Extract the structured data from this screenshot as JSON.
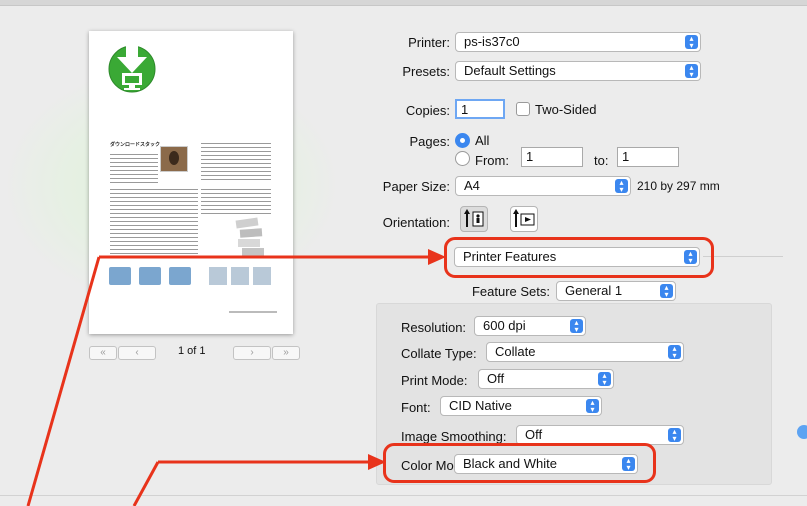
{
  "printer": {
    "label": "Printer:",
    "value": "ps-is37c0"
  },
  "presets": {
    "label": "Presets:",
    "value": "Default Settings"
  },
  "copies": {
    "label": "Copies:",
    "value": "1",
    "two_sided_label": "Two-Sided"
  },
  "pages": {
    "label": "Pages:",
    "all_label": "All",
    "from_label": "From:",
    "from_value": "1",
    "to_label": "to:",
    "to_value": "1"
  },
  "paper_size": {
    "label": "Paper Size:",
    "value": "A4",
    "dimensions": "210 by 297 mm"
  },
  "orientation": {
    "label": "Orientation:"
  },
  "section_menu": {
    "value": "Printer Features"
  },
  "feature_sets": {
    "label": "Feature Sets:",
    "value": "General 1"
  },
  "features": [
    {
      "label": "Resolution:",
      "value": "600 dpi"
    },
    {
      "label": "Collate Type:",
      "value": "Collate"
    },
    {
      "label": "Print Mode:",
      "value": "Off"
    },
    {
      "label": "Font:",
      "value": "CID Native"
    },
    {
      "label": "Image Smoothing:",
      "value": "Off"
    },
    {
      "label": "Color Mode:",
      "value": "Black and White"
    }
  ],
  "preview": {
    "title": "ダウンロードスタック",
    "page_indicator": "1 of 1"
  },
  "colors": {
    "accent": "#3b87ef",
    "highlight": "#e8331b",
    "download_green": "#3aa935"
  },
  "icons": [
    "updown-arrows-icon",
    "download-icon",
    "portrait-orientation-icon",
    "landscape-orientation-icon",
    "folder-icon",
    "first-page-icon",
    "previous-page-icon",
    "next-page-icon",
    "last-page-icon"
  ]
}
